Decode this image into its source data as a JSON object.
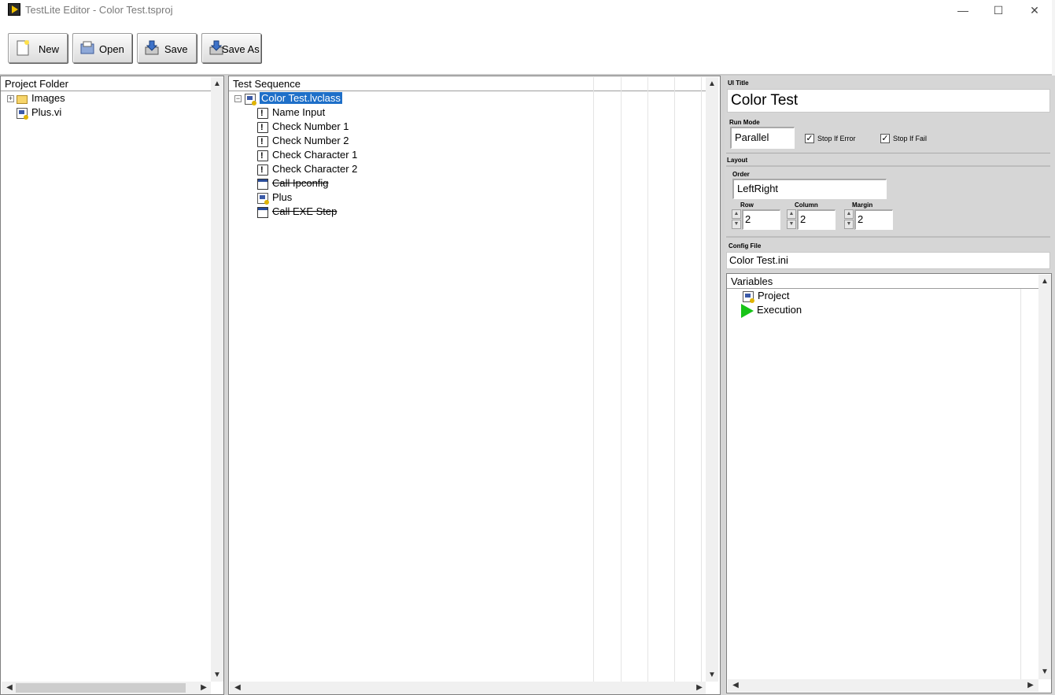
{
  "window": {
    "title": "TestLite Editor - Color Test.tsproj",
    "minimize": "—",
    "maximize": "☐",
    "close": "✕"
  },
  "toolbar": {
    "new_label": "New",
    "open_label": "Open",
    "save_label": "Save",
    "save_as_label": "Save As"
  },
  "project_folder": {
    "header": "Project Folder",
    "items": [
      {
        "label": "Images",
        "icon": "folder-icon",
        "expander": "+"
      },
      {
        "label": "Plus.vi",
        "icon": "vi-icon"
      }
    ]
  },
  "test_sequence": {
    "header": "Test Sequence",
    "root": {
      "label": "Color Test.lvclass",
      "icon": "lvclass-icon",
      "expander": "−"
    },
    "steps": [
      {
        "label": "Name Input",
        "icon": "step-icon",
        "disabled": false
      },
      {
        "label": "Check Number 1",
        "icon": "step-icon",
        "disabled": false
      },
      {
        "label": "Check Number 2",
        "icon": "step-icon",
        "disabled": false
      },
      {
        "label": "Check Character 1",
        "icon": "step-icon",
        "disabled": false
      },
      {
        "label": "Check Character 2",
        "icon": "step-icon",
        "disabled": false
      },
      {
        "label": "Call Ipconfig",
        "icon": "window-icon",
        "disabled": true
      },
      {
        "label": "Plus",
        "icon": "vi-icon",
        "disabled": false
      },
      {
        "label": "Call EXE Step",
        "icon": "window-icon",
        "disabled": true
      }
    ]
  },
  "properties": {
    "ui_title_label": "UI Title",
    "ui_title_value": "Color Test",
    "run_mode_label": "Run Mode",
    "run_mode_value": "Parallel",
    "stop_if_error_label": "Stop If Error",
    "stop_if_error_checked": true,
    "stop_if_fail_label": "Stop If Fail",
    "stop_if_fail_checked": true,
    "layout_label": "Layout",
    "order_label": "Order",
    "order_value": "LeftRight",
    "row_label": "Row",
    "row_value": "2",
    "column_label": "Column",
    "column_value": "2",
    "margin_label": "Margin",
    "margin_value": "2",
    "config_file_label": "Config File",
    "config_file_value": "Color Test.ini"
  },
  "variables": {
    "header": "Variables",
    "items": [
      {
        "label": "Project",
        "icon": "lvclass-icon"
      },
      {
        "label": "Execution",
        "icon": "play-icon"
      }
    ]
  },
  "scroll": {
    "up": "▲",
    "down": "▼",
    "left": "◀",
    "right": "▶"
  },
  "check_mark": "✓",
  "spin": {
    "up": "▲",
    "down": "▼"
  },
  "colors": {
    "selection": "#1e6fc8",
    "execution_icon": "#18c418"
  }
}
